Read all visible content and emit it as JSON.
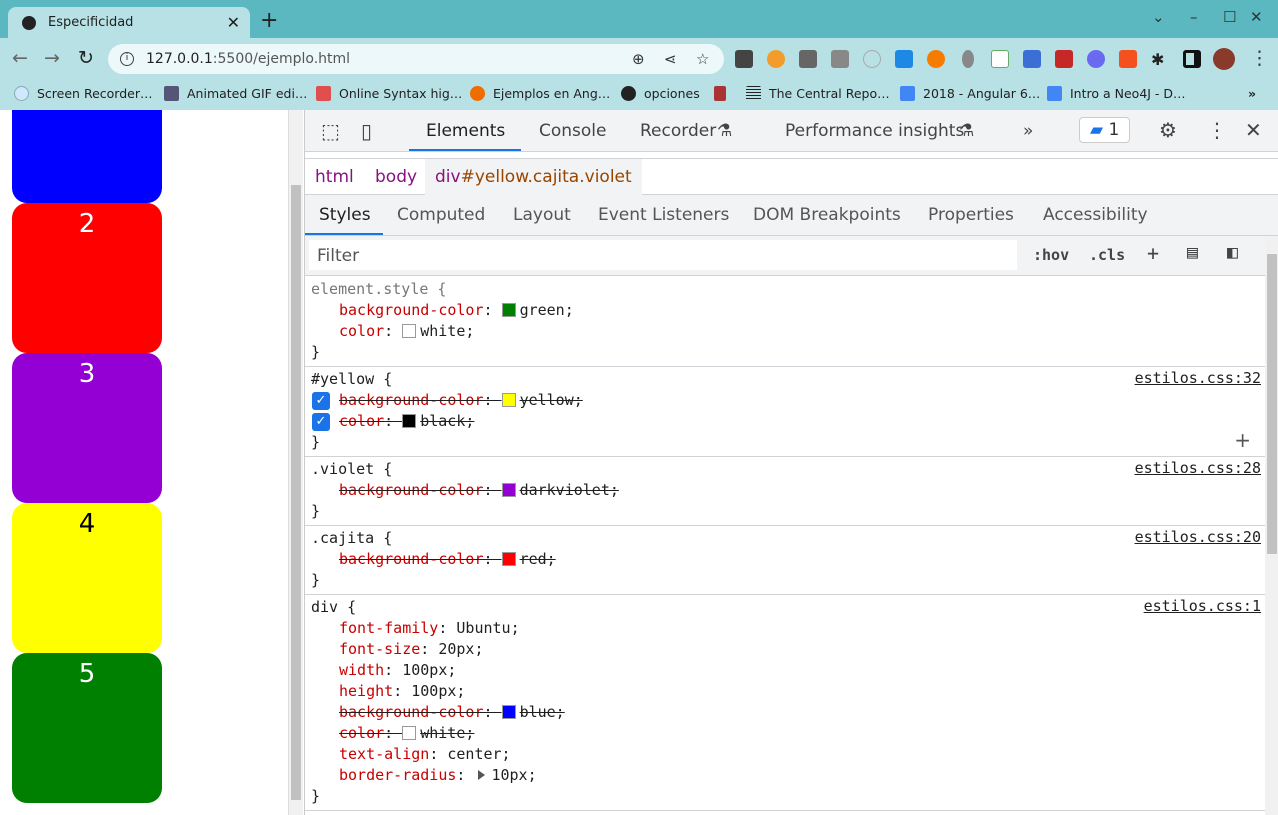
{
  "browser": {
    "tab_title": "Especificidad",
    "url_host": "127.0.0.1",
    "url_rest": ":5500/ejemplo.html",
    "bookmarks": [
      "Screen Recorder…",
      "Animated GIF edi…",
      "Online Syntax hig…",
      "Ejemplos en Ang…",
      "opciones",
      "",
      "The Central Repo…",
      "2018 - Angular 6…",
      "Intro a Neo4J - D…"
    ]
  },
  "page": {
    "boxes": [
      {
        "label": "",
        "color": "#0000ff",
        "text_color": "#ffffff"
      },
      {
        "label": "2",
        "color": "#ff0000",
        "text_color": "#ffffff"
      },
      {
        "label": "3",
        "color": "#9400d3",
        "text_color": "#ffffff"
      },
      {
        "label": "4",
        "color": "#ffff00",
        "text_color": "#000000"
      },
      {
        "label": "5",
        "color": "#008000",
        "text_color": "#ffffff"
      }
    ]
  },
  "devtools": {
    "tabs": [
      "Elements",
      "Console",
      "Recorder",
      "Performance insights"
    ],
    "issues_count": "1",
    "breadcrumb": {
      "html": "html",
      "body": "body",
      "selected_tag": "div",
      "selected_rest": "#yellow.cajita.violet"
    },
    "subtabs": [
      "Styles",
      "Computed",
      "Layout",
      "Event Listeners",
      "DOM Breakpoints",
      "Properties",
      "Accessibility"
    ],
    "filter_placeholder": "Filter",
    "hov": ":hov",
    "cls": ".cls",
    "rules": [
      {
        "selector": "element.style {",
        "source": "",
        "gray": true,
        "props": [
          {
            "name": "background-color",
            "value": "green;",
            "swatch": "#008000",
            "struck": false
          },
          {
            "name": "color",
            "value": "white;",
            "swatch": "#ffffff",
            "struck": false
          }
        ]
      },
      {
        "selector": "#yellow {",
        "source": "estilos.css:32",
        "checkboxes": true,
        "add": true,
        "props": [
          {
            "name": "background-color",
            "value": "yellow;",
            "swatch": "#ffff00",
            "struck": true
          },
          {
            "name": "color",
            "value": "black;",
            "swatch": "#000000",
            "struck": true
          }
        ]
      },
      {
        "selector": ".violet {",
        "source": "estilos.css:28",
        "props": [
          {
            "name": "background-color",
            "value": "darkviolet;",
            "swatch": "#9400d3",
            "struck": true
          }
        ]
      },
      {
        "selector": ".cajita {",
        "source": "estilos.css:20",
        "props": [
          {
            "name": "background-color",
            "value": "red;",
            "swatch": "#ff0000",
            "struck": true
          }
        ]
      },
      {
        "selector": "div {",
        "source": "estilos.css:1",
        "props": [
          {
            "name": "font-family",
            "value": "Ubuntu;",
            "struck": false
          },
          {
            "name": "font-size",
            "value": "20px;",
            "struck": false
          },
          {
            "name": "width",
            "value": "100px;",
            "struck": false
          },
          {
            "name": "height",
            "value": "100px;",
            "struck": false
          },
          {
            "name": "background-color",
            "value": "blue;",
            "swatch": "#0000ff",
            "struck": true
          },
          {
            "name": "color",
            "value": "white;",
            "swatch": "#ffffff",
            "struck": true
          },
          {
            "name": "text-align",
            "value": "center;",
            "struck": false
          },
          {
            "name": "border-radius",
            "value": "10px;",
            "struck": false,
            "expandable": true
          }
        ]
      }
    ]
  }
}
